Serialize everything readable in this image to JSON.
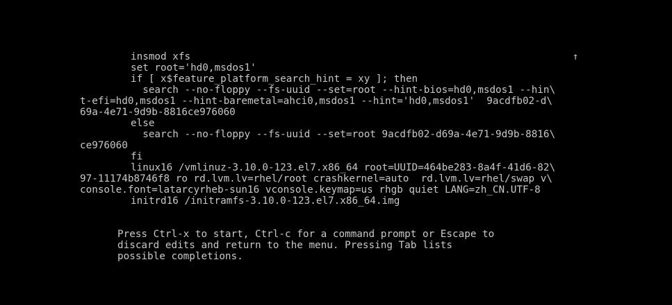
{
  "editor": {
    "scroll_indicator": "↑",
    "lines": [
      "insmod xfs",
      "set root='hd0,msdos1'",
      "if [ x$feature_platform_search_hint = xy ]; then",
      "  search --no-floppy --fs-uuid --set=root --hint-bios=hd0,msdos1 --hin\\",
      "t-efi=hd0,msdos1 --hint-baremetal=ahci0,msdos1 --hint='hd0,msdos1'  9acdfb02-d\\",
      "69a-4e71-9d9b-8816ce976060",
      "else",
      "  search --no-floppy --fs-uuid --set=root 9acdfb02-d69a-4e71-9d9b-8816\\",
      "ce976060",
      "fi",
      "linux16 /vmlinuz-3.10.0-123.el7.x86_64 root=UUID=464be283-8a4f-41d6-82\\",
      "97-11174b8746f8 ro rd.lvm.lv=rhel/root crashkernel=auto  rd.lvm.lv=rhel/swap v\\",
      "console.font=latarcyrheb-sun16 vconsole.keymap=us rhgb quiet LANG=zh_CN.UTF-8",
      "initrd16 /initramfs-3.10.0-123.el7.x86_64.img"
    ]
  },
  "help": {
    "lines": [
      "Press Ctrl-x to start, Ctrl-c for a command prompt or Escape to",
      "discard edits and return to the menu. Pressing Tab lists",
      "possible completions."
    ]
  },
  "colors": {
    "background": "#000000",
    "text": "#c8c8c8"
  }
}
